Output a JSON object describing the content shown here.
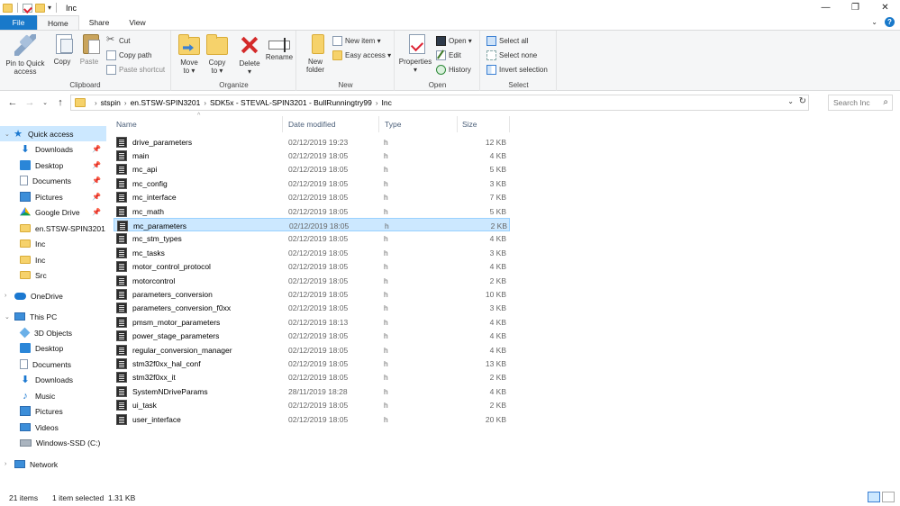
{
  "window": {
    "title": "Inc",
    "controls": [
      "—",
      "❐",
      "✕"
    ]
  },
  "tabs": {
    "file": "File",
    "home": "Home",
    "share": "Share",
    "view": "View"
  },
  "ribbon": {
    "clipboard": {
      "pin": [
        "Pin to Quick",
        "access"
      ],
      "copy": "Copy",
      "paste": "Paste",
      "cut": "Cut",
      "copy_path": "Copy path",
      "paste_shortcut": "Paste shortcut",
      "label": "Clipboard"
    },
    "organize": {
      "move_to": [
        "Move",
        "to ▾"
      ],
      "copy_to": [
        "Copy",
        "to ▾"
      ],
      "delete": [
        "Delete",
        "▾"
      ],
      "rename": "Rename",
      "label": "Organize"
    },
    "new": {
      "new_folder": [
        "New",
        "folder"
      ],
      "new_item": "New item ▾",
      "easy_access": "Easy access ▾",
      "label": "New"
    },
    "open": {
      "properties": [
        "Properties",
        "▾"
      ],
      "open": "Open ▾",
      "edit": "Edit",
      "history": "History",
      "label": "Open"
    },
    "select": {
      "select_all": "Select all",
      "select_none": "Select none",
      "invert": "Invert selection",
      "label": "Select"
    }
  },
  "address": {
    "crumbs": [
      "stspin",
      "en.STSW-SPIN3201",
      "SDK5x - STEVAL-SPIN3201 - BullRunningtry99",
      "Inc"
    ],
    "search_placeholder": "Search Inc"
  },
  "nav_pane": {
    "quick_access": "Quick access",
    "items": [
      {
        "label": "Downloads",
        "icon": "download-icon",
        "pinned": true
      },
      {
        "label": "Desktop",
        "icon": "desktop-icon",
        "pinned": true
      },
      {
        "label": "Documents",
        "icon": "documents-icon",
        "pinned": true
      },
      {
        "label": "Pictures",
        "icon": "pictures-icon",
        "pinned": true
      },
      {
        "label": "Google Drive",
        "icon": "google-drive-icon",
        "pinned": true
      },
      {
        "label": "en.STSW-SPIN3201",
        "icon": "folder-icon",
        "pinned": false
      },
      {
        "label": "Inc",
        "icon": "folder-icon",
        "pinned": false
      },
      {
        "label": "Inc",
        "icon": "folder-icon",
        "pinned": false
      },
      {
        "label": "Src",
        "icon": "folder-icon",
        "pinned": false
      }
    ],
    "onedrive": "OneDrive",
    "this_pc": "This PC",
    "pc_items": [
      {
        "label": "3D Objects",
        "icon": "3d-objects-icon"
      },
      {
        "label": "Desktop",
        "icon": "desktop-icon"
      },
      {
        "label": "Documents",
        "icon": "documents-icon"
      },
      {
        "label": "Downloads",
        "icon": "download-icon"
      },
      {
        "label": "Music",
        "icon": "music-icon"
      },
      {
        "label": "Pictures",
        "icon": "pictures-icon"
      },
      {
        "label": "Videos",
        "icon": "videos-icon"
      },
      {
        "label": "Windows-SSD (C:)",
        "icon": "drive-icon"
      }
    ],
    "network": "Network"
  },
  "columns": {
    "name": "Name",
    "date": "Date modified",
    "type": "Type",
    "size": "Size"
  },
  "files": [
    {
      "name": "drive_parameters",
      "date": "02/12/2019 19:23",
      "type": "h",
      "size": "12 KB"
    },
    {
      "name": "main",
      "date": "02/12/2019 18:05",
      "type": "h",
      "size": "4 KB"
    },
    {
      "name": "mc_api",
      "date": "02/12/2019 18:05",
      "type": "h",
      "size": "5 KB"
    },
    {
      "name": "mc_config",
      "date": "02/12/2019 18:05",
      "type": "h",
      "size": "3 KB"
    },
    {
      "name": "mc_interface",
      "date": "02/12/2019 18:05",
      "type": "h",
      "size": "7 KB"
    },
    {
      "name": "mc_math",
      "date": "02/12/2019 18:05",
      "type": "h",
      "size": "5 KB"
    },
    {
      "name": "mc_parameters",
      "date": "02/12/2019 18:05",
      "type": "h",
      "size": "2 KB"
    },
    {
      "name": "mc_stm_types",
      "date": "02/12/2019 18:05",
      "type": "h",
      "size": "4 KB"
    },
    {
      "name": "mc_tasks",
      "date": "02/12/2019 18:05",
      "type": "h",
      "size": "3 KB"
    },
    {
      "name": "motor_control_protocol",
      "date": "02/12/2019 18:05",
      "type": "h",
      "size": "4 KB"
    },
    {
      "name": "motorcontrol",
      "date": "02/12/2019 18:05",
      "type": "h",
      "size": "2 KB"
    },
    {
      "name": "parameters_conversion",
      "date": "02/12/2019 18:05",
      "type": "h",
      "size": "10 KB"
    },
    {
      "name": "parameters_conversion_f0xx",
      "date": "02/12/2019 18:05",
      "type": "h",
      "size": "3 KB"
    },
    {
      "name": "pmsm_motor_parameters",
      "date": "02/12/2019 18:13",
      "type": "h",
      "size": "4 KB"
    },
    {
      "name": "power_stage_parameters",
      "date": "02/12/2019 18:05",
      "type": "h",
      "size": "4 KB"
    },
    {
      "name": "regular_conversion_manager",
      "date": "02/12/2019 18:05",
      "type": "h",
      "size": "4 KB"
    },
    {
      "name": "stm32f0xx_hal_conf",
      "date": "02/12/2019 18:05",
      "type": "h",
      "size": "13 KB"
    },
    {
      "name": "stm32f0xx_it",
      "date": "02/12/2019 18:05",
      "type": "h",
      "size": "2 KB"
    },
    {
      "name": "SystemNDriveParams",
      "date": "28/11/2019 18:28",
      "type": "h",
      "size": "4 KB"
    },
    {
      "name": "ui_task",
      "date": "02/12/2019 18:05",
      "type": "h",
      "size": "2 KB"
    },
    {
      "name": "user_interface",
      "date": "02/12/2019 18:05",
      "type": "h",
      "size": "20 KB"
    }
  ],
  "selected_file": "mc_parameters",
  "status": {
    "count": "21 items",
    "selection": "1 item selected",
    "size": "1.31 KB"
  }
}
